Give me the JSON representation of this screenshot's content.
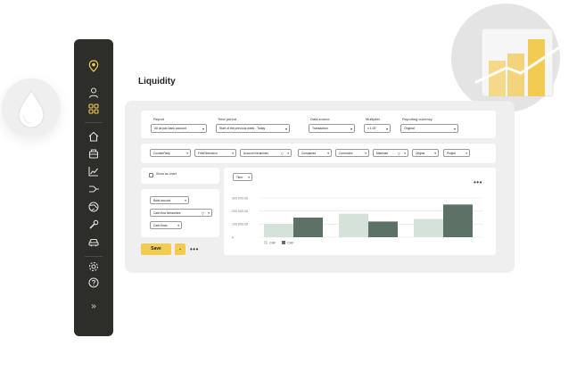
{
  "page": {
    "title": "Liquidity"
  },
  "sidebar": {
    "icons": [
      "location-pin-icon",
      "user-icon",
      "grid-icon",
      "home-icon",
      "bank-icon",
      "line-chart-icon",
      "flow-icon",
      "globe-icon",
      "wrench-icon",
      "car-icon",
      "settings-icon",
      "help-icon"
    ],
    "expand_label": "»"
  },
  "filters": {
    "report": {
      "label": "Report",
      "value": "All uk pax bank account"
    },
    "time_period": {
      "label": "Time period",
      "value": "Start of the previous week - Today"
    },
    "data_source": {
      "label": "Data source",
      "value": "Transaction"
    },
    "multiplier": {
      "label": "Multiplier",
      "value": "x 1.00"
    },
    "reporting_currency": {
      "label": "Reporting currency",
      "value": "Original"
    }
  },
  "dimension_chips": [
    "CounterParty",
    "FreeDimension",
    "Account hierarchies",
    "Companies",
    "Currencies",
    "Materials",
    "Origins",
    "Project"
  ],
  "options": {
    "show_as_chart": "Show as chart",
    "row_selectors": [
      "Bank account",
      "Cash flow hierarchies",
      "Cash flows"
    ]
  },
  "toolbar": {
    "save_label": "Save",
    "save_dropdown": "⌄",
    "more": "•••"
  },
  "chart_toolbar": {
    "axis_select": "Time",
    "more": "•••"
  },
  "colors": {
    "sidebar_bg": "#2d2d2a",
    "accent_yellow": "#f2cc52",
    "series_light": "#d4e2d9",
    "series_dark": "#5e7166"
  },
  "chart_data": {
    "type": "bar",
    "categories": [
      "",
      "",
      ""
    ],
    "series": [
      {
        "name": "CHF",
        "values": [
          100000,
          180000,
          140000
        ]
      },
      {
        "name": "CHF",
        "values": [
          150000,
          120000,
          250000
        ]
      }
    ],
    "ylim": [
      0,
      300000
    ],
    "yticks": [
      "300 000.00",
      "200 000.00",
      "100 000.00",
      "0"
    ],
    "grid": true,
    "legend": "bottom-left"
  },
  "decor_chart": {
    "type": "bar",
    "values": [
      40,
      48,
      64
    ],
    "trend_line": true
  }
}
